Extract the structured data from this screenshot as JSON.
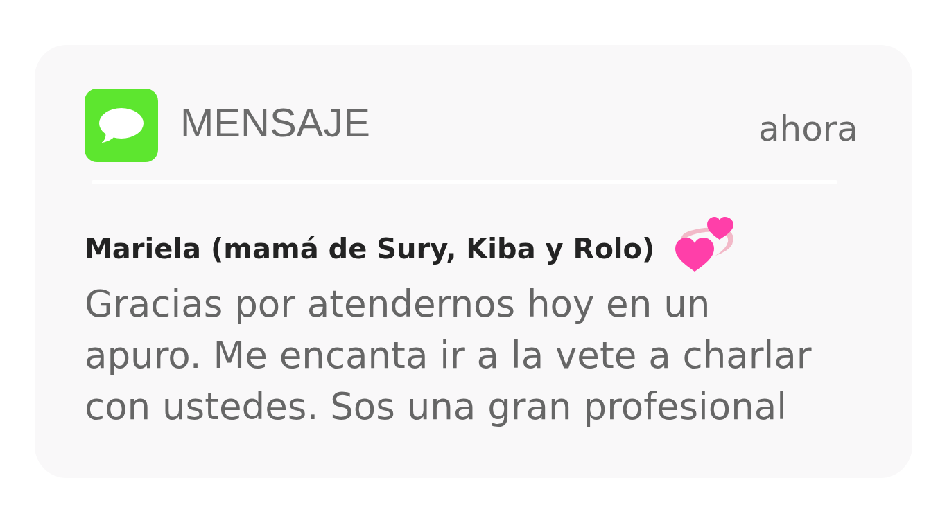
{
  "notification": {
    "app_name": "MENSAJE",
    "time": "ahora",
    "sender": "Mariela (mamá de Sury, Kiba y Rolo)",
    "message": "Gracias por atendernos hoy en un apuro. Me encanta ir a la vete a charlar con ustedes. Sos una gran profesional"
  }
}
